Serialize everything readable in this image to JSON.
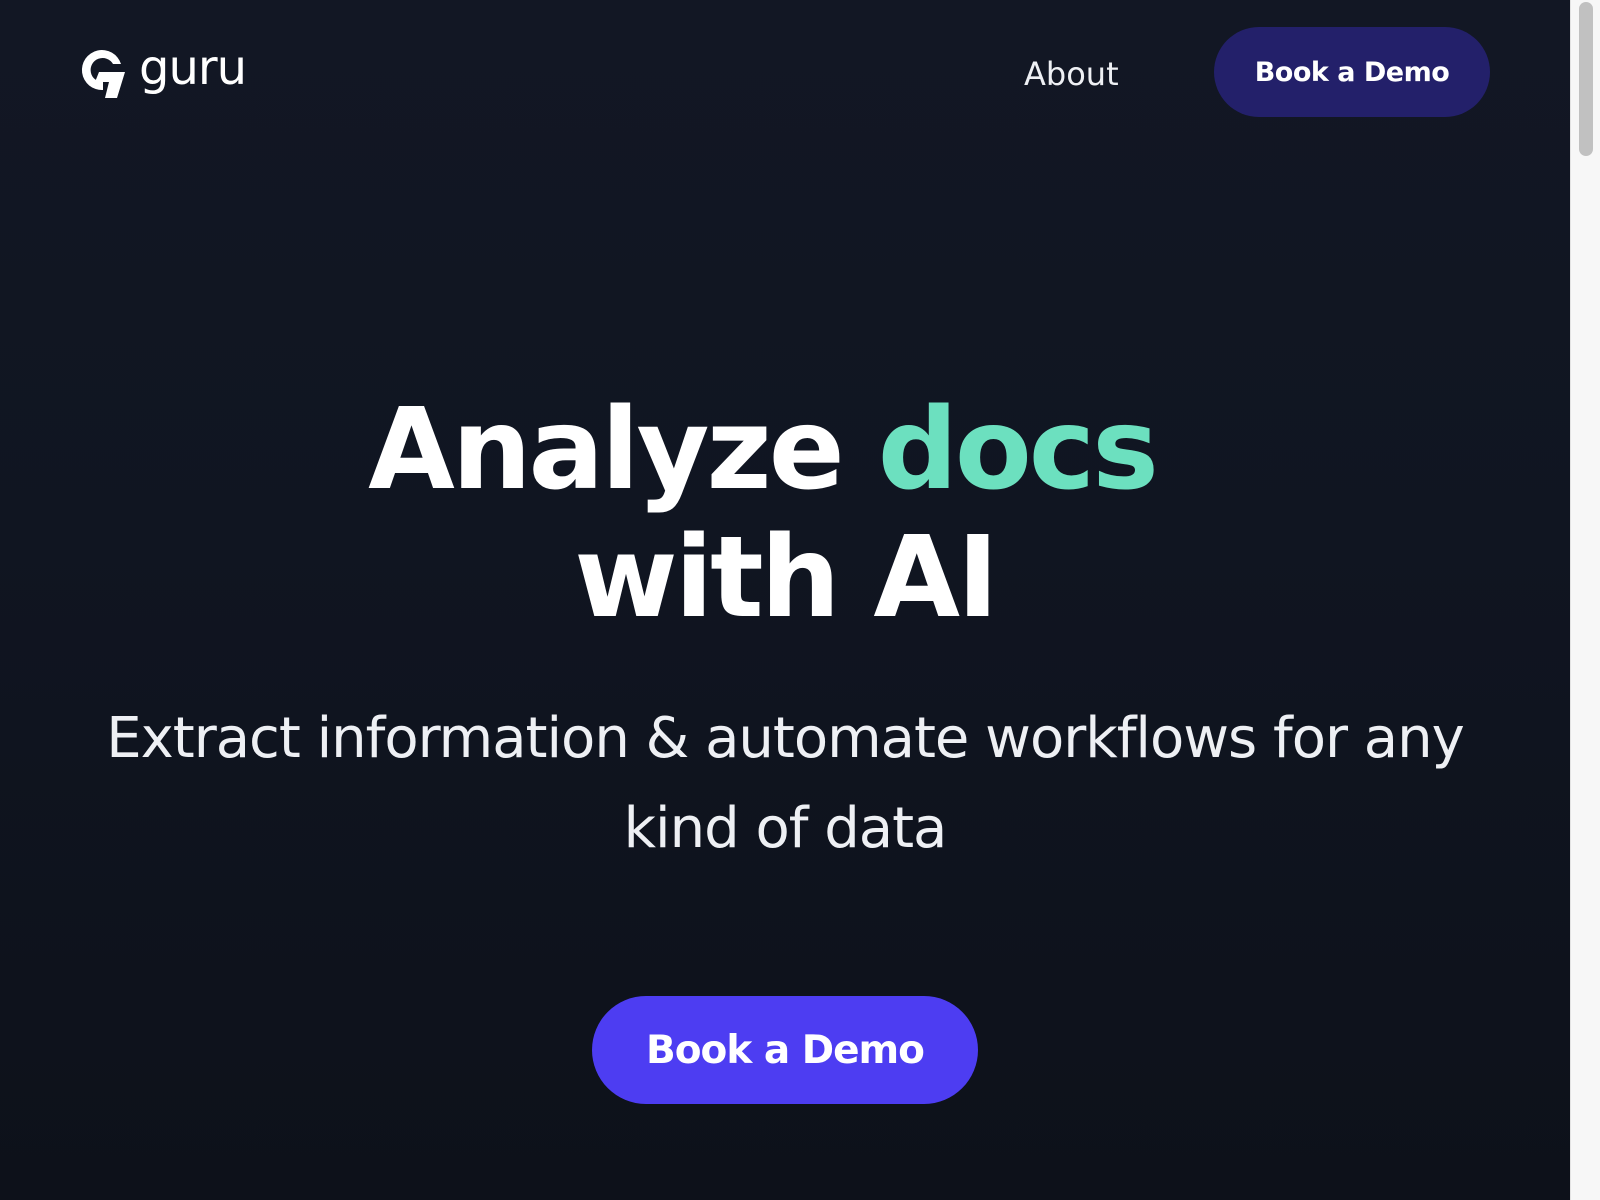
{
  "header": {
    "logo_icon": "guru-g-logo-icon",
    "logo_text": "guru",
    "nav_about": "About",
    "cta_label": "Book a Demo"
  },
  "hero": {
    "title_part1": "Analyze",
    "title_accent": "docs",
    "title_line2": "with AI",
    "subtitle": "Extract information & automate workflows for any kind of data",
    "cta_label": "Book a Demo"
  },
  "colors": {
    "background": "#11151f",
    "accent_text": "#6ce0bf",
    "header_cta_bg": "#23206a",
    "hero_cta_bg": "#4d3df2",
    "text": "#ffffff"
  }
}
